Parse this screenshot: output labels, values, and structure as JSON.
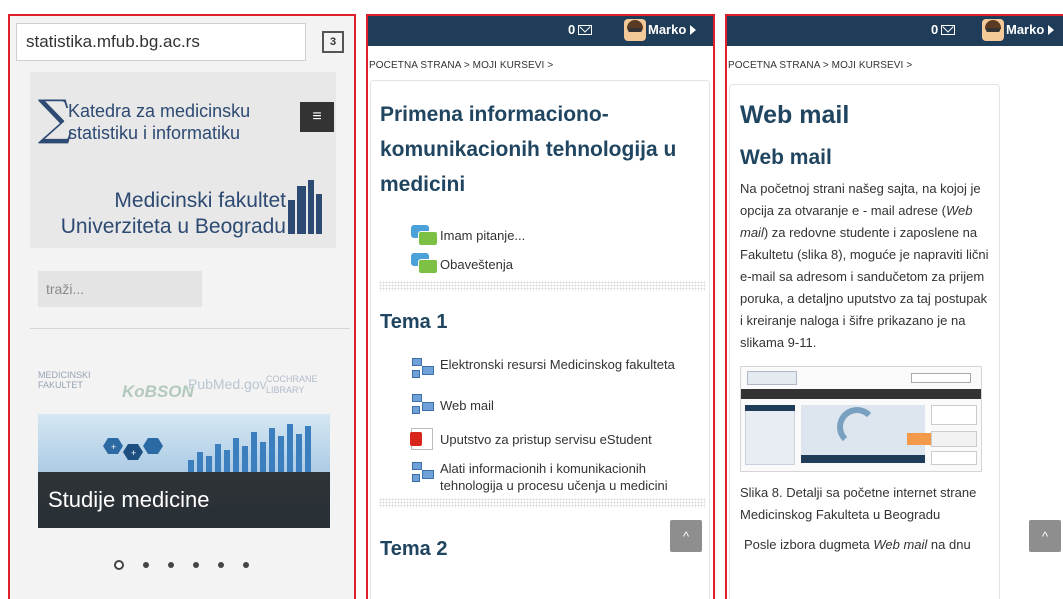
{
  "panel1": {
    "url": "statistika.mfub.bg.ac.rs",
    "tab_count": "3",
    "banner": {
      "sigma": "∑",
      "katedra_line1": "Katedra za medicinsku",
      "katedra_line2": "statistiku i informatiku",
      "medfak_line1": "Medicinski fakultet",
      "medfak_line2": "Univerziteta u Beogradu",
      "menu_icon": "≡"
    },
    "search_placeholder": "traži...",
    "logos": {
      "l1": "MEDICINSKI FAKULTET",
      "l2": "KoBSON",
      "l3": "PubMed.gov",
      "l4": "COCHRANE LIBRARY"
    },
    "slide_caption": "Studije medicine",
    "dots": 6,
    "active_dot": 0
  },
  "moodle": {
    "message_count": "0",
    "user": "Marko",
    "breadcrumb": "POCETNA STRANA > MOJI KURSEVI >"
  },
  "panel2": {
    "course_title_lines": [
      "Primena informaciono-",
      "komunikacionih tehnologija u",
      "medicini"
    ],
    "top_activities": [
      "Imam pitanje...",
      "Obaveštenja"
    ],
    "tema1": "Tema 1",
    "tema1_items": [
      {
        "icon": "resource-icon",
        "label": "Elektronski resursi Medicinskog fakulteta"
      },
      {
        "icon": "resource-icon",
        "label": "Web mail"
      },
      {
        "icon": "pdf-icon",
        "label": "Uputstvo za pristup servisu eStudent"
      },
      {
        "icon": "resource-icon",
        "label": "Alati informacionih i komunikacionih tehnologija u procesu učenja u medicini"
      }
    ],
    "tema2": "Tema 2",
    "scroll_top": "^"
  },
  "panel3": {
    "h1": "Web mail",
    "h2": "Web mail",
    "para1_a": "Na početnoj strani našeg sajta, na kojoj je opcija za otvaranje e - mail adrese (",
    "para1_em": "Web mail",
    "para1_b": ") za redovne studente i zaposlene na Fakultetu (slika 8), moguće je napraviti lični e-mail sa adresom i sandučetom za prijem poruka, a detaljno uputstvo za taj postupak i kreiranje naloga i šifre prikazano je na slikama 9-11.",
    "caption": "Slika 8. Detalji sa početne internet strane Medicinskog Fakulteta u Beogradu",
    "para2_a": "Posle izbora dugmeta ",
    "para2_em": "Web mail",
    "para2_b": " na dnu",
    "scroll_top": "^"
  },
  "colors": {
    "border_red": "#e0202a",
    "header_navy": "#1f3d58",
    "heading_blue": "#1f4560"
  }
}
